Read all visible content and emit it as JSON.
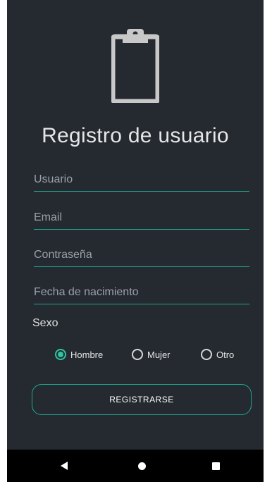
{
  "title": "Registro de usuario",
  "icon": "clipboard-icon",
  "form": {
    "usuario_placeholder": "Usuario",
    "email_placeholder": "Email",
    "password_placeholder": "Contraseña",
    "birthdate_placeholder": "Fecha de nacimiento",
    "sex_label": "Sexo",
    "sex_options": [
      "Hombre",
      "Mujer",
      "Otro"
    ],
    "sex_selected": "Hombre",
    "submit_label": "REGISTRARSE"
  },
  "colors": {
    "background": "#252a31",
    "accent": "#1fa68e",
    "radio_checked": "#2ec4a0",
    "icon": "#c8c8c8",
    "navbar": "#000000"
  },
  "navbar": {
    "back_icon": "back-triangle-icon",
    "home_icon": "home-circle-icon",
    "recents_icon": "recents-square-icon"
  }
}
